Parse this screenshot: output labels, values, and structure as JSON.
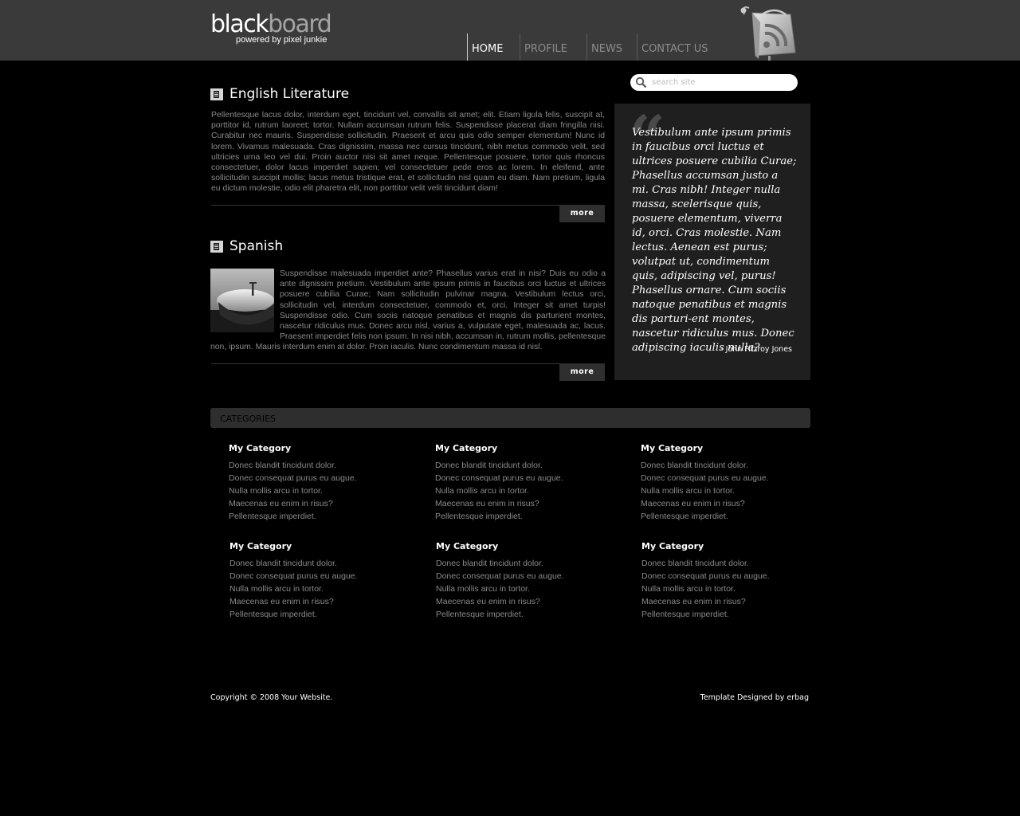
{
  "brand": {
    "name_light": "black",
    "name_bold": "board",
    "tagline": "powered by pixel junkie"
  },
  "nav": {
    "items": [
      {
        "label": "HOME"
      },
      {
        "label": "PROFILE"
      },
      {
        "label": "NEWS"
      },
      {
        "label": "CONTACT US"
      }
    ],
    "active": "HOME"
  },
  "search": {
    "placeholder": "search site"
  },
  "articles": [
    {
      "title": "English Literature",
      "body": "Pellentesque lacus dolor, interdum eget, tincidunt vel, convallis sit amet; elit. Etiam ligula felis, suscipit at, porttitor id, rutrum laoreet; tortor. Nullam accumsan rutrum felis. Suspendisse placerat diam fringilla nisi. Curabitur nec mauris. Suspendisse sollicitudin. Praesent et arcu quis odio semper elementum! Nunc id lorem. Vivamus malesuada. Cras dignissim, massa nec cursus tincidunt, nibh metus commodo velit, sed ultricies urna leo vel dui. Proin auctor nisi sit amet neque. Pellentesque posuere, tortor quis rhoncus consectetuer, dolor lacus imperdiet sapien; vel consectetuer pede eros ac lorem. In eleifend, ante sollicitudin suscipit mollis; lacus metus tristique erat, et sollicitudin nisl quam eu diam. Nam pretium, ligula eu dictum molestie, odio elit pharetra elit, non porttitor velit velit tincidunt diam!",
      "more": "more"
    },
    {
      "title": "Spanish",
      "body": "Suspendisse malesuada imperdiet ante? Phasellus varius erat in nisi? Duis eu odio a ante dignissim pretium. Vestibulum ante ipsum primis in faucibus orci luctus et ultrices posuere cubilia Curae; Nam sollicitudin pulvinar magna. Vestibulum lectus orci, sollicitudin vel, interdum consectetuer, commodo et, orci. Integer sit amet turpis! Suspendisse odio. Cum sociis natoque penatibus et magnis dis parturient montes, nascetur ridiculus mus. Donec arcu nisl, varius a, vulputate eget, malesuada ac, lacus. Praesent imperdiet felis non ipsum. In nisi nibh, accumsan in, rutrum mollis, pellentesque non, ipsum. Mauris interdum enim at dolor. Proin iaculis. Nunc condimentum massa id nisl.",
      "more": "more"
    }
  ],
  "quote": {
    "mark": "“",
    "text": "Vestibulum ante ipsum primis in faucibus orci luctus et ultrices posuere cubilia Curae; Phasellus accumsan justo a mi. Cras nibh! Integer nulla massa, scelerisque quis, posuere elementum, viverra id, orci. Cras molestie. Nam lectus. Aenean est purus; volutpat ut, condimentum quis, adipiscing vel, purus! Phasellus ornare. Cum sociis natoque penatibus et magnis dis parturi-ent montes, nascetur ridiculus mus. Donec adipiscing iaculis nulla?",
    "author": "- John Fitzroy Jones"
  },
  "categories": {
    "heading": "CATEGORIES",
    "columns": [
      {
        "title": "My Category",
        "links": [
          "Donec blandit tincidunt dolor.",
          "Donec consequat purus eu augue.",
          "Nulla mollis arcu in tortor.",
          "Maecenas eu enim in risus?",
          "Pellentesque imperdiet."
        ]
      },
      {
        "title": "My Category",
        "links": [
          "Donec blandit tincidunt dolor.",
          "Donec consequat purus eu augue.",
          "Nulla mollis arcu in tortor.",
          "Maecenas eu enim in risus?",
          "Pellentesque imperdiet."
        ]
      },
      {
        "title": "My Category",
        "links": [
          "Donec blandit tincidunt dolor.",
          "Donec consequat purus eu augue.",
          "Nulla mollis arcu in tortor.",
          "Maecenas eu enim in risus?",
          "Pellentesque imperdiet."
        ]
      },
      {
        "title": "My Category",
        "links": [
          "Donec blandit tincidunt dolor.",
          "Donec consequat purus eu augue.",
          "Nulla mollis arcu in tortor.",
          "Maecenas eu enim in risus?",
          "Pellentesque imperdiet."
        ]
      },
      {
        "title": "My Category",
        "links": [
          "Donec blandit tincidunt dolor.",
          "Donec consequat purus eu augue.",
          "Nulla mollis arcu in tortor.",
          "Maecenas eu enim in risus?",
          "Pellentesque imperdiet."
        ]
      },
      {
        "title": "My Category",
        "links": [
          "Donec blandit tincidunt dolor.",
          "Donec consequat purus eu augue.",
          "Nulla mollis arcu in tortor.",
          "Maecenas eu enim in risus?",
          "Pellentesque imperdiet."
        ]
      }
    ]
  },
  "footer": {
    "copyright": "Copyright © 2008 Your Website.",
    "credit": "Template Designed by erbag"
  },
  "icons": {
    "search": "search-icon",
    "rss": "rss-feed-icon",
    "article": "document-icon"
  },
  "colors": {
    "header_bg": "#3a3a3a",
    "page_bg": "#000000",
    "panel_bg": "#1f1f1f",
    "button_bg": "#2f2f2f"
  }
}
